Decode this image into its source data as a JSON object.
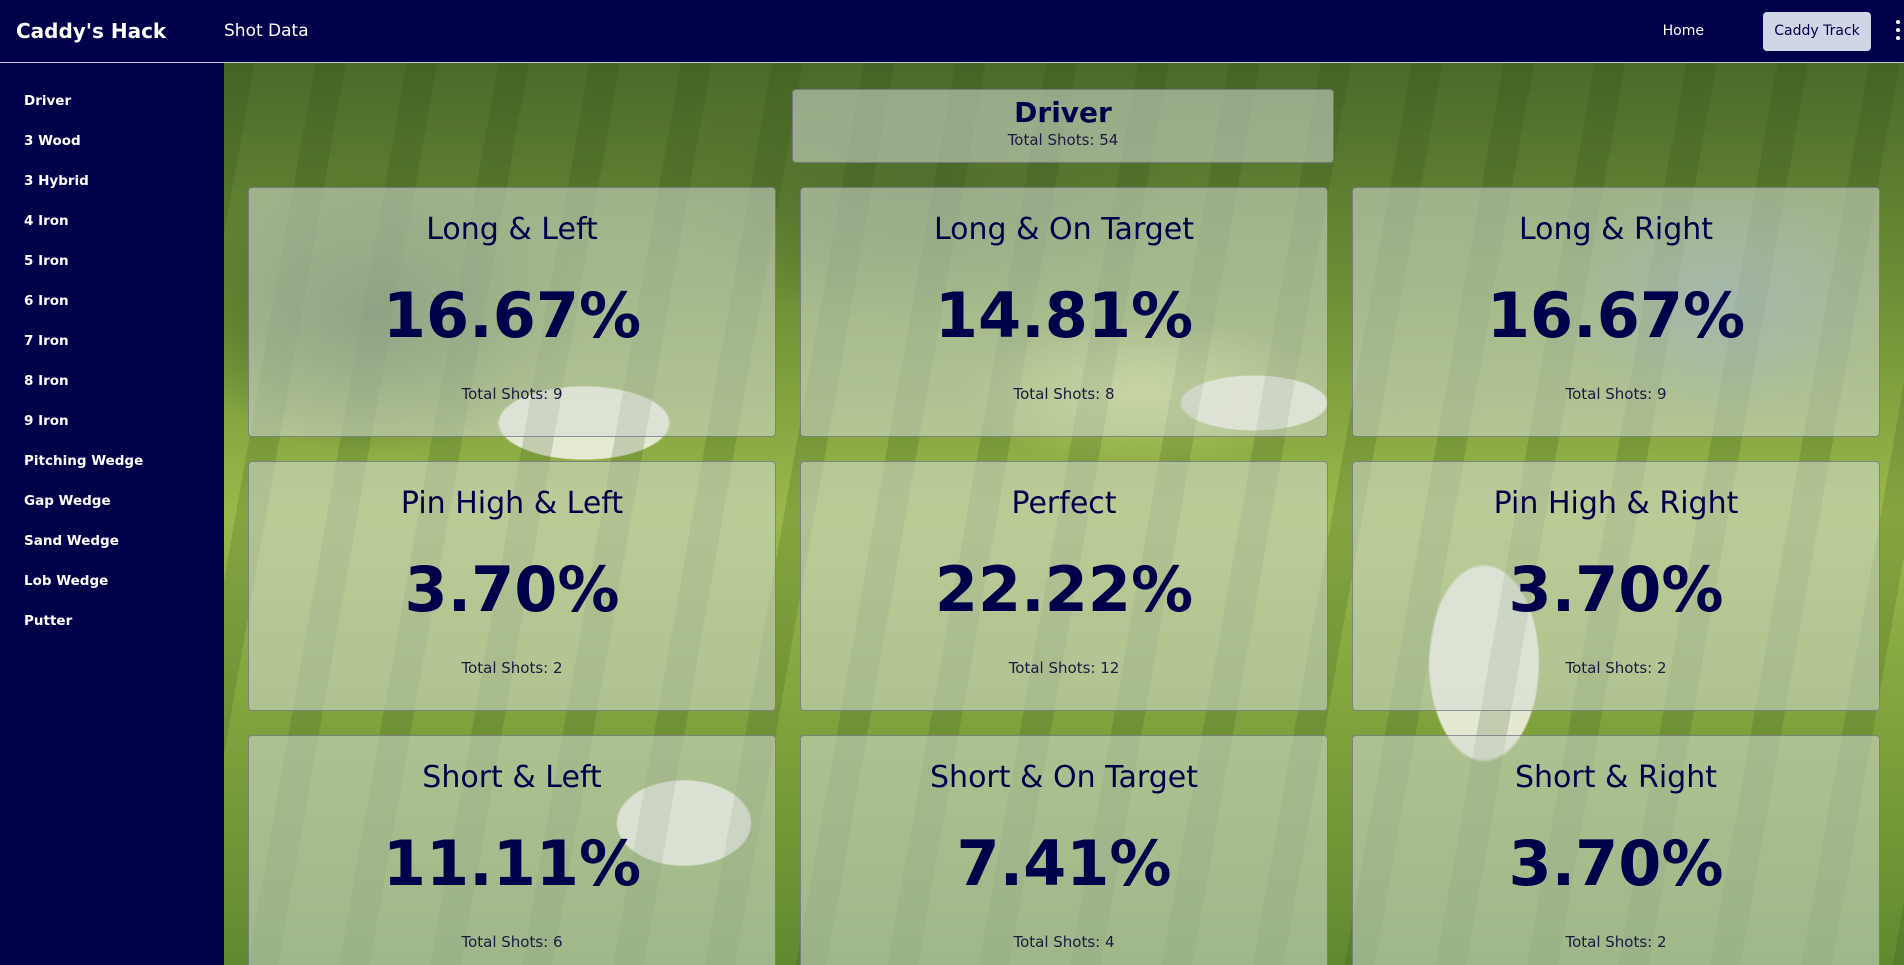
{
  "app": {
    "brand": "Caddy's Hack",
    "page_title": "Shot Data"
  },
  "nav": {
    "home": "Home",
    "caddy_track": "Caddy Track",
    "more_icon": "kebab-menu-icon"
  },
  "sidebar": {
    "items": [
      {
        "label": "Driver"
      },
      {
        "label": "3 Wood"
      },
      {
        "label": "3 Hybrid"
      },
      {
        "label": "4 Iron"
      },
      {
        "label": "5 Iron"
      },
      {
        "label": "6 Iron"
      },
      {
        "label": "7 Iron"
      },
      {
        "label": "8 Iron"
      },
      {
        "label": "9 Iron"
      },
      {
        "label": "Pitching Wedge"
      },
      {
        "label": "Gap Wedge"
      },
      {
        "label": "Sand Wedge"
      },
      {
        "label": "Lob Wedge"
      },
      {
        "label": "Putter"
      }
    ]
  },
  "club": {
    "name": "Driver",
    "total": "Total Shots: 54"
  },
  "cards": [
    {
      "title": "Long & Left",
      "percent": "16.67%",
      "shots": "Total Shots: 9"
    },
    {
      "title": "Long & On Target",
      "percent": "14.81%",
      "shots": "Total Shots: 8"
    },
    {
      "title": "Long & Right",
      "percent": "16.67%",
      "shots": "Total Shots: 9"
    },
    {
      "title": "Pin High & Left",
      "percent": "3.70%",
      "shots": "Total Shots: 2"
    },
    {
      "title": "Perfect",
      "percent": "22.22%",
      "shots": "Total Shots: 12"
    },
    {
      "title": "Pin High & Right",
      "percent": "3.70%",
      "shots": "Total Shots: 2"
    },
    {
      "title": "Short & Left",
      "percent": "11.11%",
      "shots": "Total Shots: 6"
    },
    {
      "title": "Short & On Target",
      "percent": "7.41%",
      "shots": "Total Shots: 4"
    },
    {
      "title": "Short & Right",
      "percent": "3.70%",
      "shots": "Total Shots: 2"
    }
  ],
  "colors": {
    "navy": "#00004a",
    "button_bg": "#cfd6e6",
    "card_overlay": "rgba(214,220,214,0.55)"
  }
}
